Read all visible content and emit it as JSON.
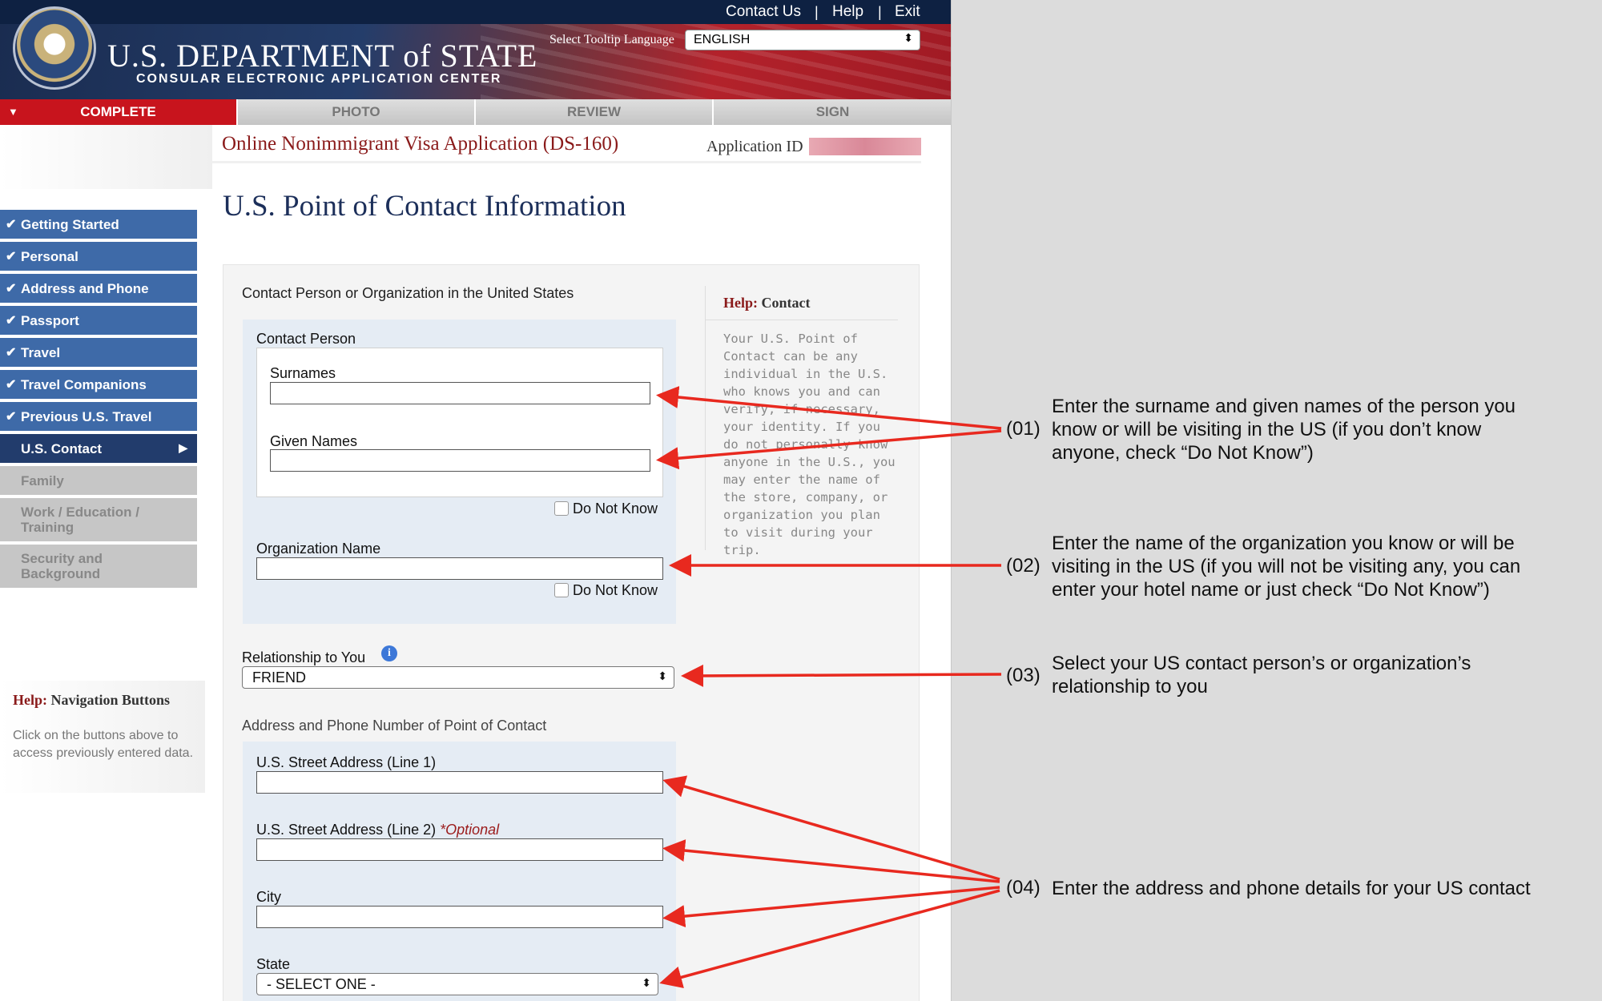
{
  "header": {
    "utility_links": [
      "Contact Us",
      "Help",
      "Exit"
    ],
    "dept_title": "U.S. DEPARTMENT of STATE",
    "dept_subtitle": "CONSULAR ELECTRONIC APPLICATION CENTER",
    "tooltip_language_label": "Select Tooltip Language",
    "tooltip_language_value": "ENGLISH"
  },
  "tabs": [
    {
      "label": "COMPLETE",
      "active": true
    },
    {
      "label": "PHOTO",
      "active": false
    },
    {
      "label": "REVIEW",
      "active": false
    },
    {
      "label": "SIGN",
      "active": false
    }
  ],
  "title_bar": {
    "form_title": "Online Nonimmigrant Visa Application (DS-160)",
    "application_id_label": "Application ID"
  },
  "page_title": "U.S. Point of Contact Information",
  "sidebar": {
    "items": [
      {
        "label": "Getting Started",
        "state": "done"
      },
      {
        "label": "Personal",
        "state": "done"
      },
      {
        "label": "Address and Phone",
        "state": "done"
      },
      {
        "label": "Passport",
        "state": "done"
      },
      {
        "label": "Travel",
        "state": "done"
      },
      {
        "label": "Travel Companions",
        "state": "done"
      },
      {
        "label": "Previous U.S. Travel",
        "state": "done"
      },
      {
        "label": "U.S. Contact",
        "state": "current"
      },
      {
        "label": "Family",
        "state": "todo"
      },
      {
        "label_line1": "Work / Education /",
        "label_line2": "Training",
        "state": "todo"
      },
      {
        "label_line1": "Security and",
        "label_line2": "Background",
        "state": "todo"
      }
    ],
    "help_title_prefix": "Help:",
    "help_title": "Navigation Buttons",
    "help_text": "Click on the buttons above to access previously entered data."
  },
  "form": {
    "section_contact": "Contact Person or Organization in the United States",
    "contact_person_label": "Contact Person",
    "surnames_label": "Surnames",
    "surnames_value": "",
    "given_names_label": "Given Names",
    "given_names_value": "",
    "do_not_know_label": "Do Not Know",
    "organization_label": "Organization Name",
    "organization_value": "",
    "relationship_label": "Relationship to You",
    "relationship_value": "FRIEND",
    "section_address": "Address and Phone Number of Point of Contact",
    "street1_label": "U.S. Street Address (Line 1)",
    "street2_label": "U.S. Street Address (Line 2)",
    "optional_label": "*Optional",
    "city_label": "City",
    "state_label": "State",
    "state_value": "- SELECT ONE -"
  },
  "help_contact": {
    "title_prefix": "Help:",
    "title": "Contact",
    "text": "Your U.S. Point of Contact can be any individual in the U.S. who knows you and can verify, if necessary, your identity. If you do not personally know anyone in the U.S., you may enter the name of the store, company, or organization you plan to visit during your trip."
  },
  "annotations": [
    {
      "num": "(01)",
      "lines": [
        "Enter the surname and given names of the person you",
        "know or will be visiting in the US (if you don’t know",
        "anyone, check “Do Not Know”)"
      ]
    },
    {
      "num": "(02)",
      "lines": [
        "Enter the name of the organization you know or will be",
        "visiting in the US (if you will not be visiting any, you can",
        "enter your hotel name or just check “Do Not Know”)"
      ]
    },
    {
      "num": "(03)",
      "lines": [
        "Select your US contact person’s or organization’s",
        "relationship to you"
      ]
    },
    {
      "num": "(04)",
      "lines": [
        "Enter the address and phone details for your US contact"
      ]
    }
  ],
  "colors": {
    "arrow": "#e8291f",
    "nav_done": "#3e6aa8",
    "nav_current": "#223c6c",
    "active_tab": "#c8141d"
  }
}
